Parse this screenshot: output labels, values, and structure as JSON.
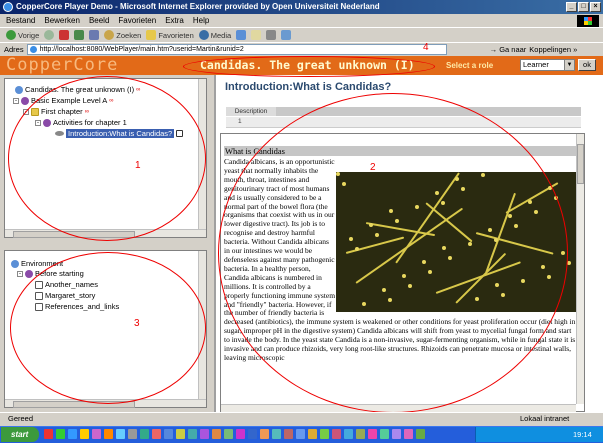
{
  "window": {
    "title": "CopperCore Player Demo - Microsoft Internet Explorer provided by Open Universiteit Nederland",
    "buttons": [
      "_",
      "□",
      "×"
    ]
  },
  "menu": [
    "Bestand",
    "Bewerken",
    "Beeld",
    "Favorieten",
    "Extra",
    "Help"
  ],
  "toolbar": {
    "back": "Vorige",
    "search": "Zoeken",
    "favorites": "Favorieten",
    "media": "Media"
  },
  "address": {
    "label": "Adres",
    "url": "http://localhost:8080/WebPlayer/main.htm?userid=Martin&runid=2",
    "go_label": "Ga naar",
    "links_label": "Koppelingen »"
  },
  "header": {
    "logo": "CopperCore",
    "title": "Candidas. The great unknown (I)",
    "role_label": "Select a role",
    "role_value": "Learner",
    "ok_label": "ok"
  },
  "tree": {
    "items": [
      {
        "label": "Candidas. The great unknown (I)"
      },
      {
        "label": "Basic Example Level A"
      },
      {
        "label": "First chapter"
      },
      {
        "label": "Activities for chapter 1"
      },
      {
        "label": "Introduction:What is Candidas?"
      }
    ]
  },
  "environment": {
    "items": [
      {
        "label": "Environment"
      },
      {
        "label": "Before starting"
      },
      {
        "label": "Another_names"
      },
      {
        "label": "Margaret_story"
      },
      {
        "label": "References_and_links"
      }
    ]
  },
  "content": {
    "title": "Introduction:What is Candidas?",
    "tab": "Description",
    "tab_number": "1",
    "heading": "What is Candidas",
    "body": "Candida albicans, is an opportunistic yeast that normally inhabits the mouth, throat, intestines and genitourinary tract of most humans and is usually considered to be a normal part of the bowel flora (the organisms that coexist with us in our lower digestive tract). Its job is to recognise and destroy harmful bacteria. Without Candida albicans in our intestines we would be defenseless against many pathogenic bacteria. In a healthy person, Candida albicans is numbered in millions. It is controlled by a properly functioning immune system and \"friendly\" bacteria. However, if the number of friendly bacteria is decreased (antibiotics), the immune system is weakened or other conditions for yeast proliferation occur (diet high in sugar, improper pH in the digestive system) Candida albicans will shift from yeast to mycelial fungal form and start to invade the body. In the yeast state Candida is a non-invasive, sugar-fermenting organism, while in fungal state it is invasive and can produce rhizoids, very long root-like structures. Rhizoids can penetrate mucosa or intestinal walls, leaving microscopic"
  },
  "annotations": [
    "1",
    "2",
    "3",
    "4"
  ],
  "status": {
    "left": "Gereed",
    "zone": "Lokaal intranet"
  },
  "taskbar": {
    "start": "start",
    "clock": "19:14"
  },
  "colors": {
    "header_bg": "#e26a18",
    "title_text": "#2b4a6f",
    "annotation": "#e00000"
  }
}
